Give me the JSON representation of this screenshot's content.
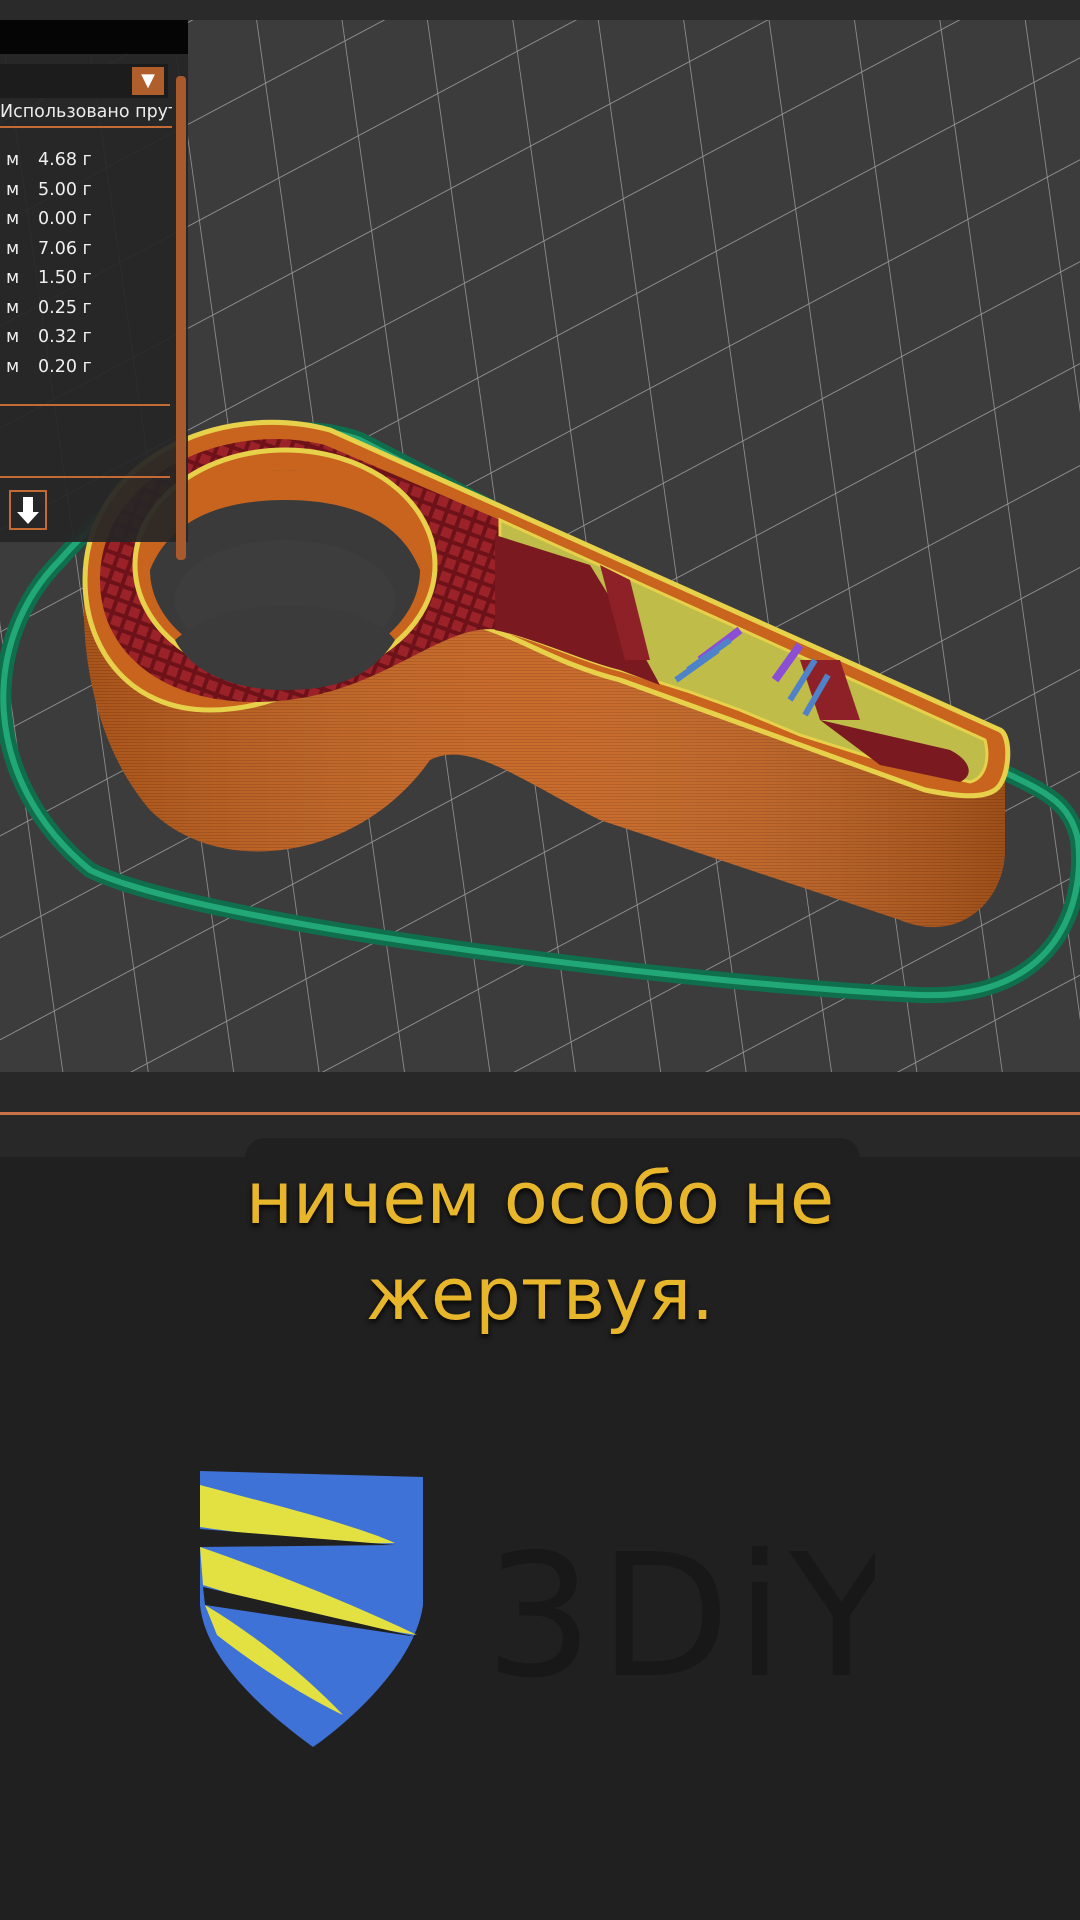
{
  "panel": {
    "column_header": "Использовано прутка",
    "rows": [
      {
        "unit": "м",
        "weight": "4.68 г"
      },
      {
        "unit": "м",
        "weight": "5.00 г"
      },
      {
        "unit": "м",
        "weight": "0.00 г"
      },
      {
        "unit": "м",
        "weight": "7.06 г"
      },
      {
        "unit": "м",
        "weight": "1.50 г"
      },
      {
        "unit": "м",
        "weight": "0.25 г"
      },
      {
        "unit": "м",
        "weight": "0.32 г"
      },
      {
        "unit": "м",
        "weight": "0.20 г"
      }
    ],
    "dropdown_icon": "triangle-down-icon",
    "export_icon": "download-arrow-icon"
  },
  "subtitle": {
    "line1": "ничем особо не",
    "line2": "жертвуя."
  },
  "logo": {
    "text": "3DiY"
  },
  "colors": {
    "accent": "#c46a35",
    "subtitle": "#e8b62b",
    "perimeter": "#c8641e",
    "infill": "#8a1c22",
    "skirt": "#1f9a6c",
    "logo_blue": "#3f72d6",
    "logo_yellow": "#e3e042"
  }
}
